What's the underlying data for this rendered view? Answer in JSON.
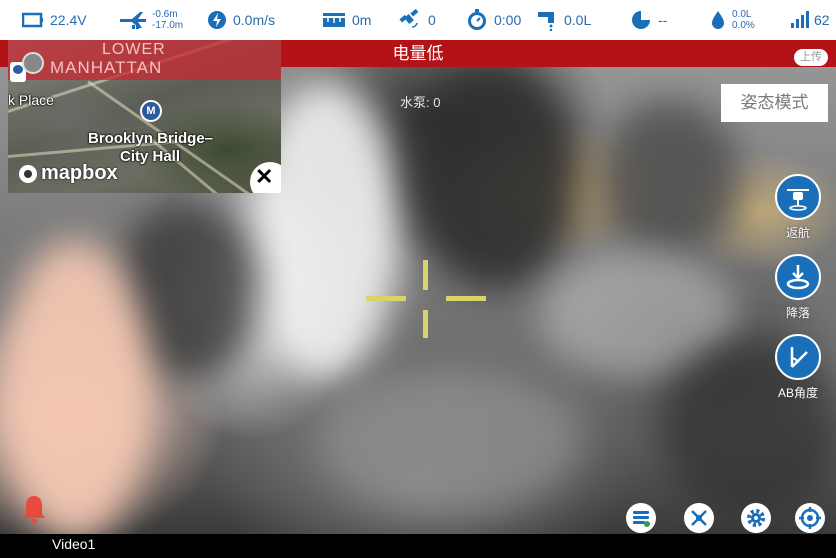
{
  "status": {
    "voltage": "22.4V",
    "altitude_top": "-0.6m",
    "altitude_bottom": "-17.0m",
    "speed": "0.0m/s",
    "distance": "0m",
    "satellites": "0",
    "timer": "0:00",
    "flow": "0.0L",
    "battery": "--",
    "tank_top": "0.0L",
    "tank_bottom": "0.0%",
    "signal": "62"
  },
  "banner": {
    "text": "电量低",
    "upload_label": "上传",
    "color": "#b31217"
  },
  "map": {
    "label_lower": "LOWER",
    "label_manhattan": "MANHATTAN",
    "label_place": "k Place",
    "label_bridge": "Brooklyn Bridge–",
    "label_cityhall": "City Hall",
    "transit_badge": "M",
    "logo_text": "mapbox"
  },
  "overlay": {
    "pump": "水泵: 0",
    "mode": "姿态模式",
    "accent": "#1a6fb8",
    "crosshair_color": "#d8d36a"
  },
  "actions": [
    {
      "label": "返航",
      "icon": "drone-return-icon"
    },
    {
      "label": "降落",
      "icon": "landing-icon"
    },
    {
      "label": "AB角度",
      "icon": "ab-angle-icon"
    }
  ],
  "bottom": {
    "video_label": "Video1"
  }
}
